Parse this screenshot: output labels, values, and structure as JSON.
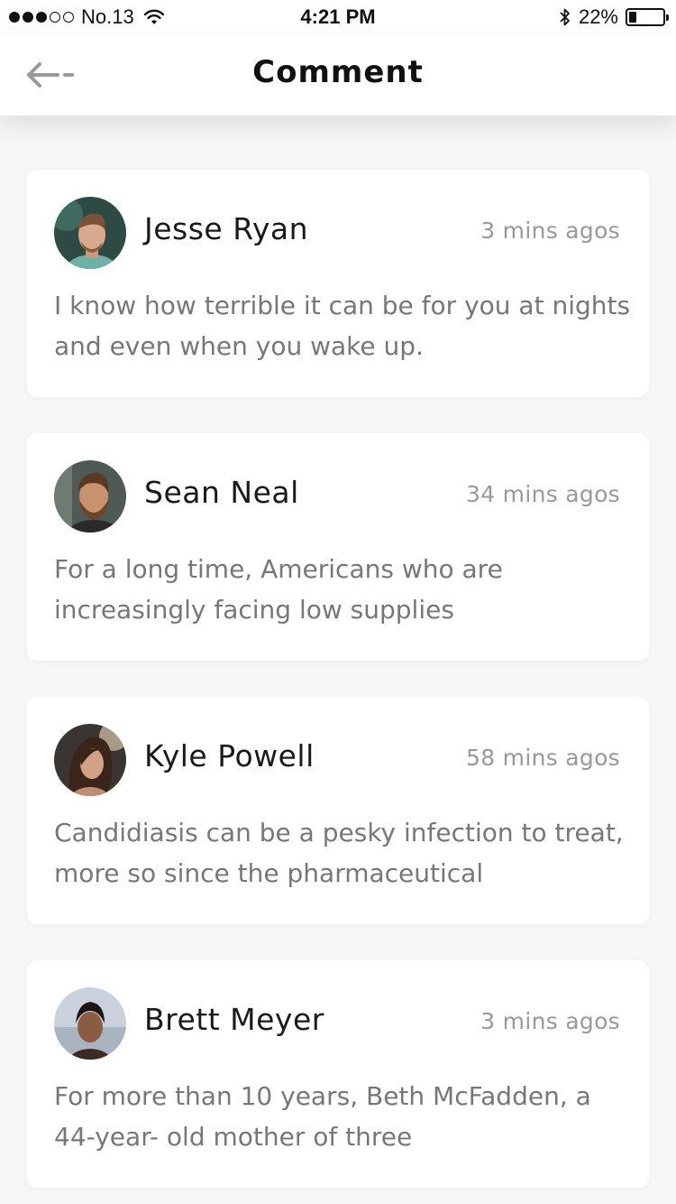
{
  "status_bar": {
    "carrier": "No.13",
    "time": "4:21 PM",
    "battery_percent": "22%",
    "battery_level": 0.22,
    "signal_bars_filled": 3,
    "signal_bars_total": 5
  },
  "header": {
    "title": "Comment",
    "back_icon": "arrow-left-icon"
  },
  "comments": [
    {
      "author": "Jesse Ryan",
      "time": "3 mins agos",
      "text": "I know how terrible it can be for you at nights and even when you wake up."
    },
    {
      "author": "Sean Neal",
      "time": "34 mins agos",
      "text": "For a long time, Americans who are increasingly facing low supplies"
    },
    {
      "author": "Kyle Powell",
      "time": "58 mins agos",
      "text": "Candidiasis can be a pesky infection to treat, more so since the pharmaceutical"
    },
    {
      "author": "Brett Meyer",
      "time": "3 mins agos",
      "text": "For more than 10 years, Beth McFadden, a 44-year- old mother of three"
    }
  ],
  "colors": {
    "background": "#f6f6f6",
    "card": "#ffffff",
    "author_text": "#1a1a1a",
    "time_text": "#999999",
    "body_text": "#777777"
  }
}
